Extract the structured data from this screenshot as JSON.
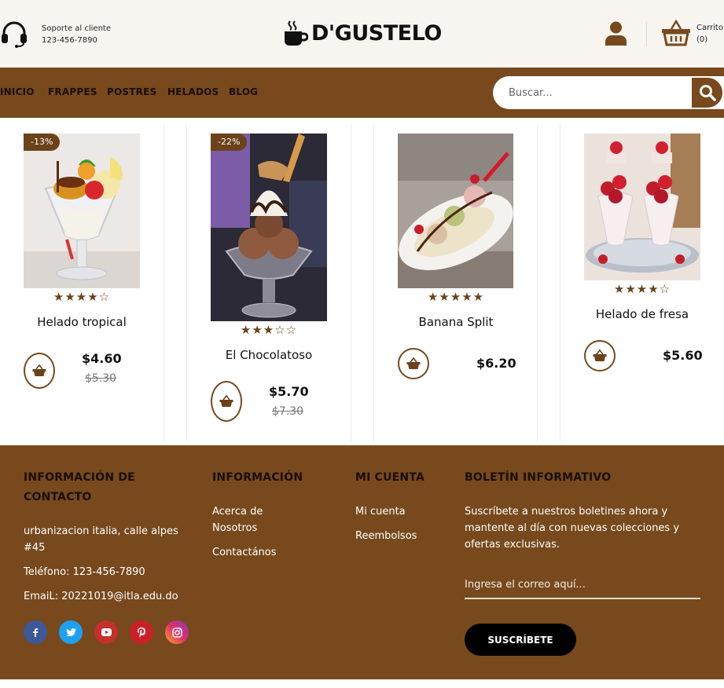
{
  "header": {
    "support_title": "Soporte al cliente",
    "support_phone": "123-456-7890",
    "brand": "D'GUSTELO",
    "cart_label": "Carrito",
    "cart_count": "(0)"
  },
  "nav": {
    "items": [
      "INICIO",
      "FRAPPES",
      "POSTRES",
      "HELADOS",
      "BLOG"
    ],
    "search_placeholder": "Buscar..."
  },
  "products": [
    {
      "name": "Helado tropical",
      "price": "$4.60",
      "old_price": "$5.30",
      "badge": "-13%",
      "rating": 4,
      "stars": "★★★★☆"
    },
    {
      "name": "El Chocolatoso",
      "price": "$5.70",
      "old_price": "$7.30",
      "badge": "-22%",
      "rating": 3,
      "stars": "★★★☆☆"
    },
    {
      "name": "Banana Split",
      "price": "$6.20",
      "old_price": "",
      "badge": "",
      "rating": 5,
      "stars": "★★★★★"
    },
    {
      "name": "Helado de fresa",
      "price": "$5.60",
      "old_price": "",
      "badge": "",
      "rating": 4,
      "stars": "★★★★☆"
    }
  ],
  "footer": {
    "contact": {
      "heading_line1": "INFORMACIÓN DE",
      "heading_line2": "CONTACTO",
      "address_line1": "urbanizacion italia, calle alpes",
      "address_line2": "#45",
      "phone": "Teléfono: 123-456-7890",
      "email": "EmaiL: 20221019@itla.edu.do"
    },
    "info": {
      "heading": "INFORMACIÓN",
      "link1_line1": "Acerca de",
      "link1_line2": "Nosotros",
      "link2": "Contactános"
    },
    "account": {
      "heading": "MI CUENTA",
      "link1": "Mi cuenta",
      "link2": "Reembolsos"
    },
    "newsletter": {
      "heading": "BOLETÍN INFORMATIVO",
      "text_line1": "Suscríbete a nuestros boletines ahora y",
      "text_line2": "mantente al día con nuevas colecciones y",
      "text_line3": "ofertas exclusivas.",
      "email_placeholder": "Ingresa el correo aquí...",
      "button": "SUSCRÍBETE"
    },
    "social": [
      "facebook-icon",
      "twitter-icon",
      "youtube-icon",
      "pinterest-icon",
      "instagram-icon"
    ]
  },
  "colors": {
    "brown": "#77491d",
    "dark_brown": "#6b4219",
    "cream": "#f8f4ef"
  }
}
